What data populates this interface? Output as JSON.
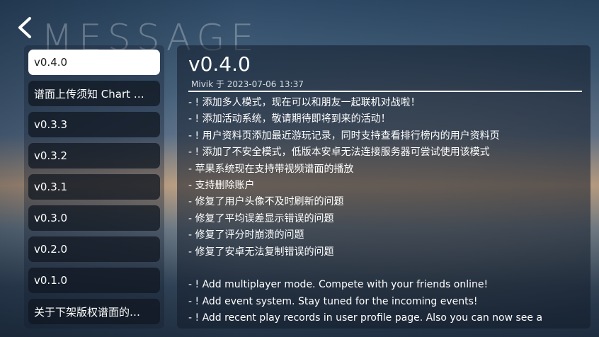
{
  "header": {
    "back_icon": "chevron-left-icon",
    "watermark": "MESSAGE"
  },
  "sidebar": {
    "items": [
      {
        "label": "v0.4.0",
        "active": true
      },
      {
        "label": "谱面上传须知 Chart …",
        "active": false
      },
      {
        "label": "v0.3.3",
        "active": false
      },
      {
        "label": "v0.3.2",
        "active": false
      },
      {
        "label": "v0.3.1",
        "active": false
      },
      {
        "label": "v0.3.0",
        "active": false
      },
      {
        "label": "v0.2.0",
        "active": false
      },
      {
        "label": "v0.1.0",
        "active": false
      },
      {
        "label": "关于下架版权谱面的…",
        "active": false
      }
    ]
  },
  "message": {
    "title": "v0.4.0",
    "meta": "Mivik 于 2023-07-06 13:37",
    "lines": [
      "- ! 添加多人模式，现在可以和朋友一起联机对战啦！",
      "- ! 添加活动系统，敬请期待即将到来的活动！",
      "- ! 用户资料页添加最近游玩记录，同时支持查看排行榜内的用户资料页",
      "- ! 添加了不安全模式，低版本安卓无法连接服务器可尝试使用该模式",
      "- 苹果系统现在支持带视频谱面的播放",
      "- 支持删除账户",
      "- 修复了用户头像不及时刷新的问题",
      "- 修复了平均误差显示错误的问题",
      "- 修复了评分时崩溃的问题",
      "- 修复了安卓无法复制错误的问题",
      "",
      "- ! Add multiplayer mode. Compete with your friends online!",
      "- ! Add event system. Stay tuned for the incoming events!",
      "- ! Add recent play records in user profile page. Also you can now see a"
    ]
  },
  "colors": {
    "active_item_bg": "#ffffff",
    "item_bg": "#0f1620",
    "text": "#ffffff"
  }
}
